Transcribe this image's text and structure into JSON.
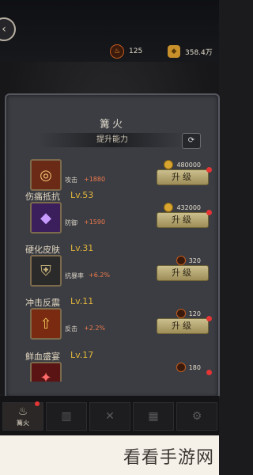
{
  "topbar": {
    "resource_ember": "125",
    "resource_gold": "358.4万"
  },
  "panel": {
    "title": "篝火",
    "subtitle": "提升能力"
  },
  "cards": [
    {
      "name": "",
      "level": "",
      "stat_label": "攻击",
      "stat_value": "+1880",
      "cost": "480000",
      "currency": "gold",
      "button": "升级",
      "icon": "target-icon",
      "notify": true
    },
    {
      "name": "伤痛抵抗",
      "level": "Lv.53",
      "stat_label": "防御",
      "stat_value": "+1590",
      "cost": "432000",
      "currency": "gold",
      "button": "升级",
      "icon": "crystal-icon",
      "notify": true
    },
    {
      "name": "硬化皮肤",
      "level": "Lv.31",
      "stat_label": "抗暴率",
      "stat_value": "+6.2%",
      "cost": "320",
      "currency": "ember",
      "button": "升级",
      "icon": "shield-icon",
      "notify": false
    },
    {
      "name": "冲击反震",
      "level": "Lv.11",
      "stat_label": "反击",
      "stat_value": "+2.2%",
      "cost": "120",
      "currency": "ember",
      "button": "升级",
      "icon": "arrow-up-icon",
      "notify": true
    },
    {
      "name": "鲜血盛宴",
      "level": "Lv.17",
      "stat_label": "",
      "stat_value": "",
      "cost": "180",
      "currency": "ember",
      "button": "",
      "icon": "blood-icon",
      "notify": true
    }
  ],
  "tabbar": {
    "active_label": "篝火"
  },
  "watermark": "看看手游网",
  "colors": {
    "accent_gold": "#e0b43a",
    "stat_orange": "#f07a4a",
    "notify_red": "#e53535"
  }
}
